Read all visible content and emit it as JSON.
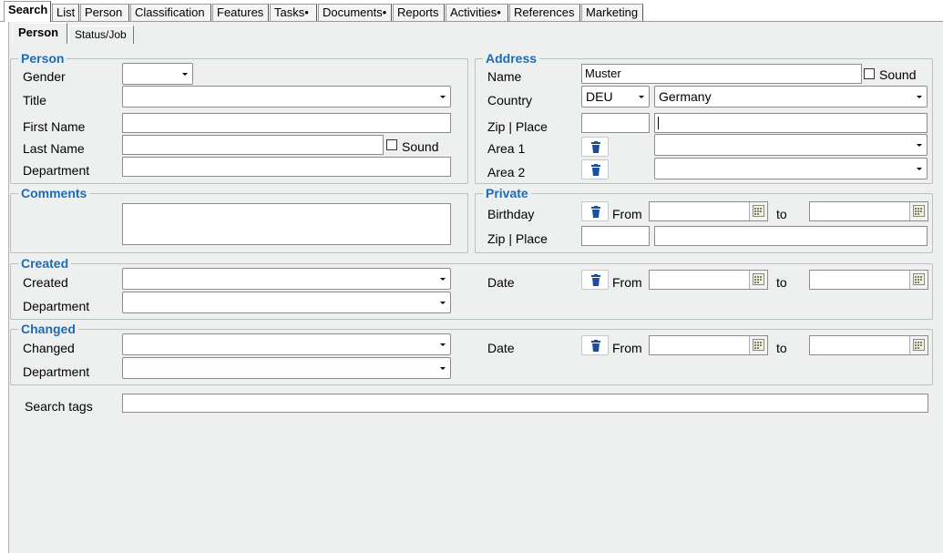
{
  "top_tabs": [
    "Search",
    "List",
    "Person",
    "Classification",
    "Features",
    "Tasks•",
    "Documents•",
    "Reports",
    "Activities•",
    "References",
    "Marketing"
  ],
  "sub_tabs": [
    "Person",
    "Status/Job"
  ],
  "person": {
    "legend": "Person",
    "gender_label": "Gender",
    "title_label": "Title",
    "first_name_label": "First Name",
    "last_name_label": "Last Name",
    "sound_label": "Sound",
    "department_label": "Department"
  },
  "address": {
    "legend": "Address",
    "name_label": "Name",
    "name_value": "Muster",
    "sound_label": "Sound",
    "country_label": "Country",
    "country_code": "DEU",
    "country_name": "Germany",
    "zip_label": "Zip | Place",
    "area1_label": "Area 1",
    "area2_label": "Area 2"
  },
  "comments": {
    "legend": "Comments"
  },
  "private": {
    "legend": "Private",
    "birthday_label": "Birthday",
    "from_label": "From",
    "to_label": "to",
    "zip_label": "Zip | Place"
  },
  "created": {
    "legend": "Created",
    "created_label": "Created",
    "department_label": "Department",
    "date_label": "Date",
    "from_label": "From",
    "to_label": "to"
  },
  "changed": {
    "legend": "Changed",
    "changed_label": "Changed",
    "department_label": "Department",
    "date_label": "Date",
    "from_label": "From",
    "to_label": "to"
  },
  "search_tags_label": "Search tags",
  "colors": {
    "accent": "#1f6bb4",
    "panel_bg": "#edf0ef",
    "icon_blue": "#1a4f9c"
  }
}
